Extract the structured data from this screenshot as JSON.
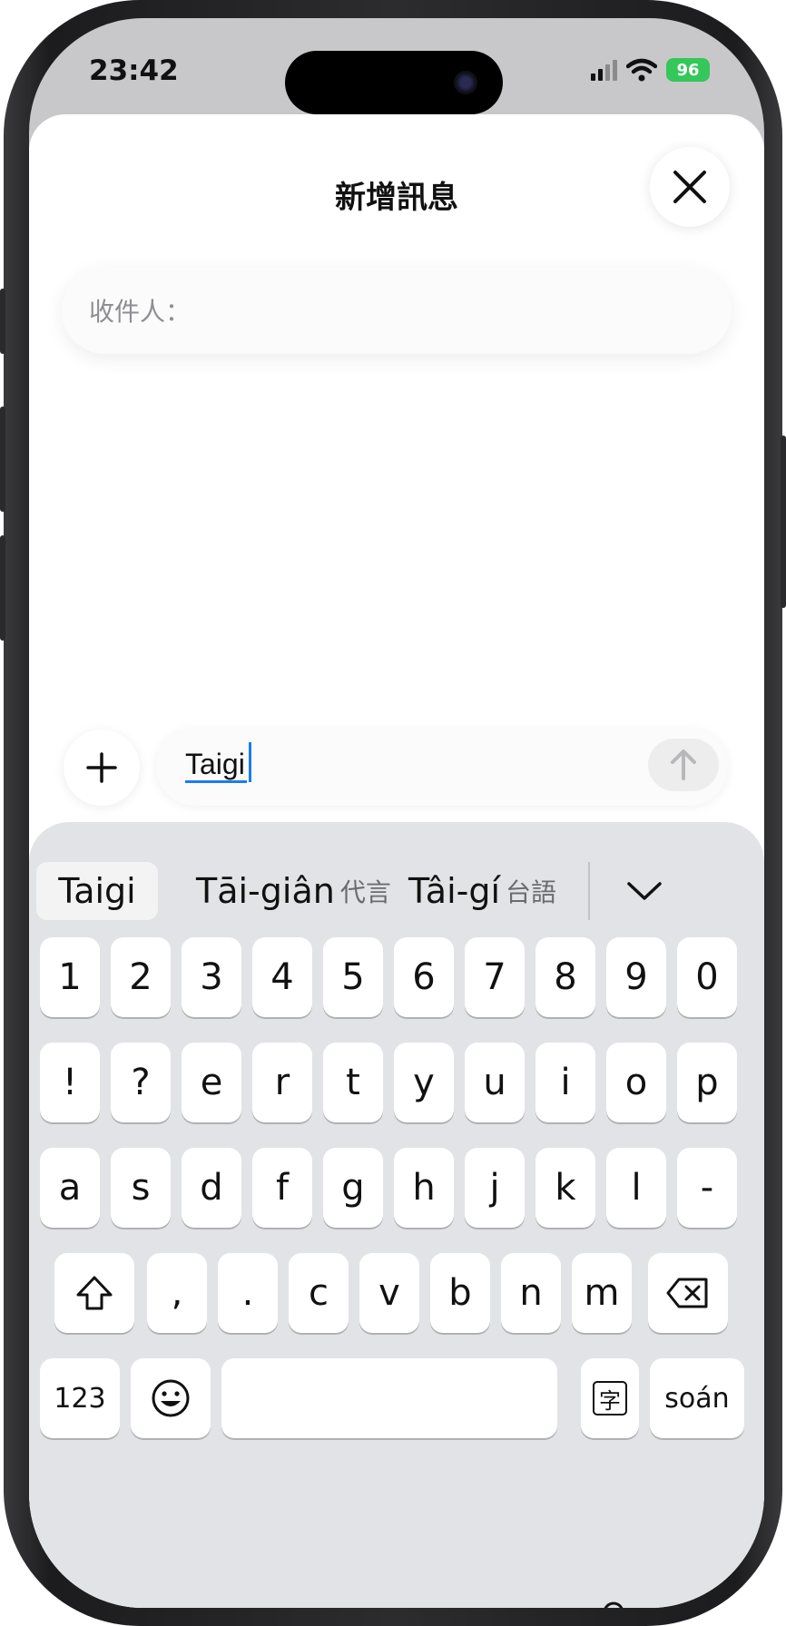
{
  "status_bar": {
    "time": "23:42",
    "battery": "96"
  },
  "sheet": {
    "title": "新增訊息",
    "to_label": "收件人："
  },
  "compose": {
    "text": "Taigi"
  },
  "suggestions": [
    {
      "roman": "Taigi",
      "han": ""
    },
    {
      "roman": "Tāi-giân",
      "han": "代言"
    },
    {
      "roman": "Tâi-gí",
      "han": "台語"
    }
  ],
  "keyboard": {
    "row_digits": [
      "1",
      "2",
      "3",
      "4",
      "5",
      "6",
      "7",
      "8",
      "9",
      "0"
    ],
    "row_top": [
      "!",
      "?",
      "e",
      "r",
      "t",
      "y",
      "u",
      "i",
      "o",
      "p"
    ],
    "row_home": [
      "a",
      "s",
      "d",
      "f",
      "g",
      "h",
      "j",
      "k",
      "l",
      "-"
    ],
    "row_bottom": [
      ",",
      ".",
      "c",
      "v",
      "b",
      "n",
      "m"
    ],
    "numbers_label": "123",
    "ime_label": "字",
    "return_label": "soán"
  },
  "icons": {
    "close": "close-icon",
    "plus": "plus-icon",
    "send": "arrow-up-icon",
    "chevron": "chevron-down-icon",
    "shift": "shift-icon",
    "delete": "delete-icon",
    "emoji": "emoji-icon",
    "globe": "globe-icon",
    "mic": "microphone-icon"
  },
  "colors": {
    "accent": "#1a7cf0",
    "battery": "#34c759"
  }
}
